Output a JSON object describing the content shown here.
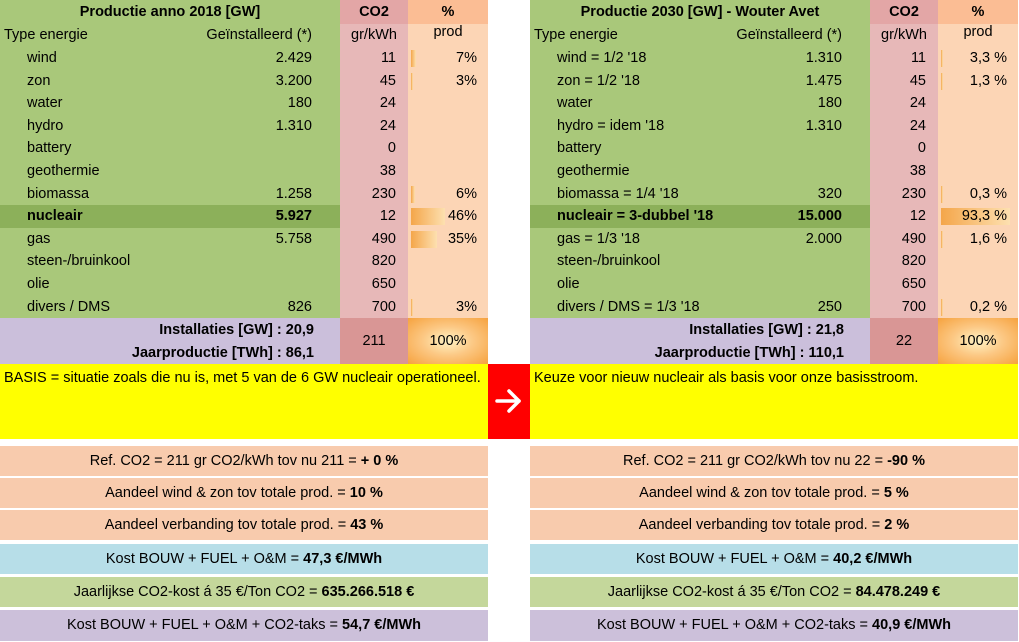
{
  "left": {
    "header": {
      "title": "Productie anno 2018 [GW]",
      "co2": "CO2",
      "pct": "%"
    },
    "subheader": {
      "type": "Type energie",
      "installed": "Geïnstalleerd (*)",
      "co2_unit": "gr/kWh",
      "prod": "prod"
    },
    "rows": [
      {
        "label": "wind",
        "installed": "2.429",
        "co2": "11",
        "pct_text": "7%",
        "pct": 7
      },
      {
        "label": "zon",
        "installed": "3.200",
        "co2": "45",
        "pct_text": "3%",
        "pct": 3
      },
      {
        "label": "water",
        "installed": "180",
        "co2": "24",
        "pct_text": "",
        "pct": 0
      },
      {
        "label": "hydro",
        "installed": "1.310",
        "co2": "24",
        "pct_text": "",
        "pct": 0
      },
      {
        "label": "battery",
        "installed": "",
        "co2": "0",
        "pct_text": "",
        "pct": 0
      },
      {
        "label": "geothermie",
        "installed": "",
        "co2": "38",
        "pct_text": "",
        "pct": 0
      },
      {
        "label": "biomassa",
        "installed": "1.258",
        "co2": "230",
        "pct_text": "6%",
        "pct": 6
      },
      {
        "label": "nucleair",
        "installed": "5.927",
        "co2": "12",
        "pct_text": "46%",
        "pct": 46,
        "highlight": true
      },
      {
        "label": "gas",
        "installed": "5.758",
        "co2": "490",
        "pct_text": "35%",
        "pct": 35
      },
      {
        "label": "steen-/bruinkool",
        "installed": "",
        "co2": "820",
        "pct_text": "",
        "pct": 0
      },
      {
        "label": "olie",
        "installed": "",
        "co2": "650",
        "pct_text": "",
        "pct": 0
      },
      {
        "label": "divers / DMS",
        "installed": "826",
        "co2": "700",
        "pct_text": "3%",
        "pct": 3
      }
    ],
    "totals": {
      "installaties": "Installaties [GW] : 20,9",
      "jaarproductie": "Jaarproductie [TWh] : 86,1",
      "co2": "211",
      "pct": "100%"
    },
    "note": "BASIS = situatie zoals die nu is, met 5 van de 6 GW nucleair operationeel.",
    "ref_co2": {
      "text": "Ref. CO2 = 211 gr CO2/kWh  tov nu 211 = ",
      "value": "+ 0 %"
    },
    "wind_zon": {
      "text": "Aandeel wind & zon tov totale prod. = ",
      "value": "10 %"
    },
    "verbanding": {
      "text": "Aandeel verbanding tov totale prod. = ",
      "value": "43 %"
    },
    "kost": {
      "text": "Kost BOUW + FUEL + O&M = ",
      "value": "47,3 €/MWh"
    },
    "co2_kost": {
      "text": "Jaarlijkse CO2-kost á 35 €/Ton CO2 = ",
      "value": "635.266.518 €"
    },
    "kost_taks": {
      "text": "Kost BOUW + FUEL + O&M + CO2-taks = ",
      "value": "54,7 €/MWh"
    }
  },
  "right": {
    "header": {
      "title": "Productie 2030 [GW] - Wouter Avet",
      "co2": "CO2",
      "pct": "%"
    },
    "subheader": {
      "type": "Type energie",
      "installed": "Geïnstalleerd (*)",
      "co2_unit": "gr/kWh",
      "prod": "prod"
    },
    "rows": [
      {
        "label": "wind = 1/2 '18",
        "installed": "1.310",
        "co2": "11",
        "pct_text": "3,3 %",
        "pct": 3.3
      },
      {
        "label": "zon = 1/2  '18",
        "installed": "1.475",
        "co2": "45",
        "pct_text": "1,3 %",
        "pct": 1.3
      },
      {
        "label": "water",
        "installed": "180",
        "co2": "24",
        "pct_text": "",
        "pct": 0
      },
      {
        "label": "hydro = idem '18",
        "installed": "1.310",
        "co2": "24",
        "pct_text": "",
        "pct": 0
      },
      {
        "label": "battery",
        "installed": "",
        "co2": "0",
        "pct_text": "",
        "pct": 0
      },
      {
        "label": "geothermie",
        "installed": "",
        "co2": "38",
        "pct_text": "",
        "pct": 0
      },
      {
        "label": "biomassa = 1/4  '18",
        "installed": "320",
        "co2": "230",
        "pct_text": "0,3 %",
        "pct": 0.3
      },
      {
        "label": "nucleair = 3-dubbel '18",
        "installed": "15.000",
        "co2": "12",
        "pct_text": "93,3 %",
        "pct": 93.3,
        "highlight": true
      },
      {
        "label": "gas = 1/3  '18",
        "installed": "2.000",
        "co2": "490",
        "pct_text": "1,6 %",
        "pct": 1.6
      },
      {
        "label": "steen-/bruinkool",
        "installed": "",
        "co2": "820",
        "pct_text": "",
        "pct": 0
      },
      {
        "label": "olie",
        "installed": "",
        "co2": "650",
        "pct_text": "",
        "pct": 0
      },
      {
        "label": "divers / DMS = 1/3  '18",
        "installed": "250",
        "co2": "700",
        "pct_text": "0,2 %",
        "pct": 0.2
      }
    ],
    "totals": {
      "installaties": "Installaties [GW] : 21,8",
      "jaarproductie": "Jaarproductie [TWh] : 110,1",
      "co2": "22",
      "pct": "100%"
    },
    "note": "Keuze voor nieuw nucleair als basis voor onze basisstroom.",
    "ref_co2": {
      "text": "Ref. CO2 = 211 gr CO2/kWh  tov nu 22 = ",
      "value": "-90 %"
    },
    "wind_zon": {
      "text": "Aandeel wind & zon tov totale prod. = ",
      "value": "5 %"
    },
    "verbanding": {
      "text": "Aandeel verbanding tov totale prod. = ",
      "value": "2 %"
    },
    "kost": {
      "text": "Kost BOUW + FUEL + O&M = ",
      "value": "40,2 €/MWh"
    },
    "co2_kost": {
      "text": "Jaarlijkse CO2-kost á 35 €/Ton CO2 = ",
      "value": "84.478.249 €"
    },
    "kost_taks": {
      "text": "Kost BOUW + FUEL + O&M + CO2-taks = ",
      "value": "40,9 €/MWh"
    }
  },
  "arrow": {
    "icon": "arrow-right-icon",
    "color": "#ff0000"
  }
}
